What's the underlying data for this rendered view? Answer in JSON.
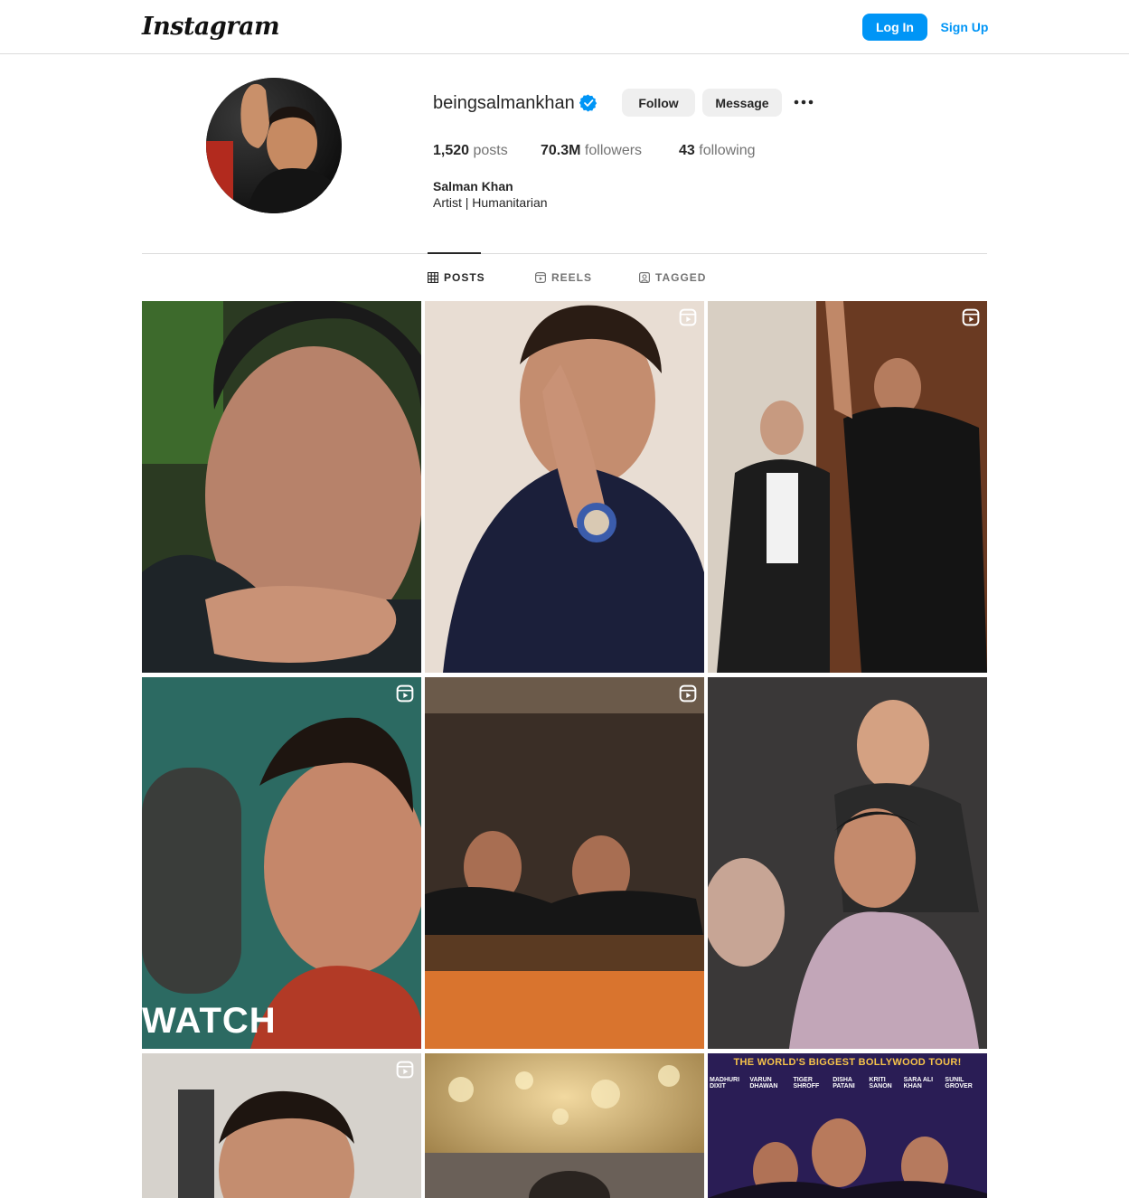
{
  "header": {
    "logo_text": "Instagram",
    "login_label": "Log In",
    "signup_label": "Sign Up"
  },
  "profile": {
    "username": "beingsalmankhan",
    "verified": true,
    "follow_label": "Follow",
    "message_label": "Message",
    "more_icon": "more-horizontal-icon",
    "posts_count": "1,520",
    "posts_label": "posts",
    "followers_count": "70.3M",
    "followers_label": "followers",
    "following_count": "43",
    "following_label": "following",
    "full_name": "Salman Khan",
    "bio": "Artist | Humanitarian"
  },
  "tabs": [
    {
      "label": "POSTS",
      "icon": "grid-icon",
      "active": true
    },
    {
      "label": "REELS",
      "icon": "reels-icon",
      "active": false
    },
    {
      "label": "TAGGED",
      "icon": "tagged-icon",
      "active": false
    }
  ],
  "posts": [
    {
      "is_reel": false,
      "overlay_text": ""
    },
    {
      "is_reel": true,
      "overlay_text": ""
    },
    {
      "is_reel": true,
      "overlay_text": ""
    },
    {
      "is_reel": true,
      "overlay_text": "WATCH"
    },
    {
      "is_reel": true,
      "overlay_text": ""
    },
    {
      "is_reel": false,
      "overlay_text": ""
    },
    {
      "is_reel": true,
      "overlay_text": ""
    },
    {
      "is_reel": false,
      "overlay_text": ""
    },
    {
      "is_reel": false,
      "overlay_text": "THE WORLD'S BIGGEST BOLLYWOOD TOUR!"
    }
  ],
  "poster_names": [
    "MADHURI DIXIT",
    "VARUN DHAWAN",
    "TIGER SHROFF",
    "DISHA PATANI",
    "KRITI SANON",
    "SARA ALI KHAN",
    "SUNIL GROVER"
  ],
  "colors": {
    "accent": "#0095f6",
    "verified": "#0095f6",
    "muted_text": "#737373",
    "border": "#dbdbdb"
  }
}
